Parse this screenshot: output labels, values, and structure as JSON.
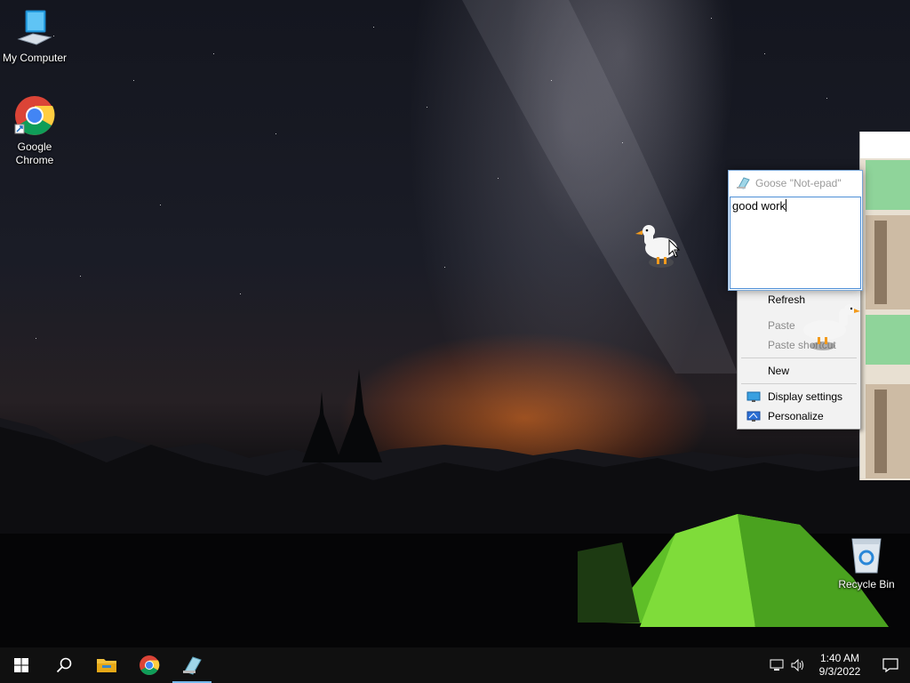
{
  "desktop": {
    "icons": [
      {
        "label": "My Computer",
        "icon": "computer-icon"
      },
      {
        "label": "Google Chrome",
        "icon": "chrome-icon"
      },
      {
        "label": "Recycle Bin",
        "icon": "recycle-bin-icon"
      }
    ]
  },
  "notepad": {
    "title": "Goose \"Not-epad\"",
    "content": "good work",
    "icon": "notepad-icon"
  },
  "context_menu": {
    "items": [
      {
        "label": "Refresh",
        "enabled": true
      },
      {
        "label": "Paste",
        "enabled": false
      },
      {
        "label": "Paste shortcut",
        "enabled": false
      },
      {
        "label": "New",
        "enabled": true
      },
      {
        "label": "Display settings",
        "enabled": true,
        "icon": "display-icon"
      },
      {
        "label": "Personalize",
        "enabled": true,
        "icon": "personalize-icon"
      }
    ]
  },
  "taskbar": {
    "buttons": [
      {
        "name": "start",
        "icon": "windows-logo-icon"
      },
      {
        "name": "search",
        "icon": "search-icon"
      },
      {
        "name": "file-explorer",
        "icon": "folder-icon"
      },
      {
        "name": "chrome",
        "icon": "chrome-icon"
      },
      {
        "name": "goose-notepad",
        "icon": "notepad-icon",
        "active": true
      }
    ],
    "tray": {
      "time": "1:40 AM",
      "date": "9/3/2022",
      "icons": [
        "network-icon",
        "volume-icon",
        "notification-icon"
      ]
    }
  },
  "colors": {
    "taskbar": "#101010",
    "accent": "#76b9ed",
    "menu_bg": "#f2f2f2"
  }
}
